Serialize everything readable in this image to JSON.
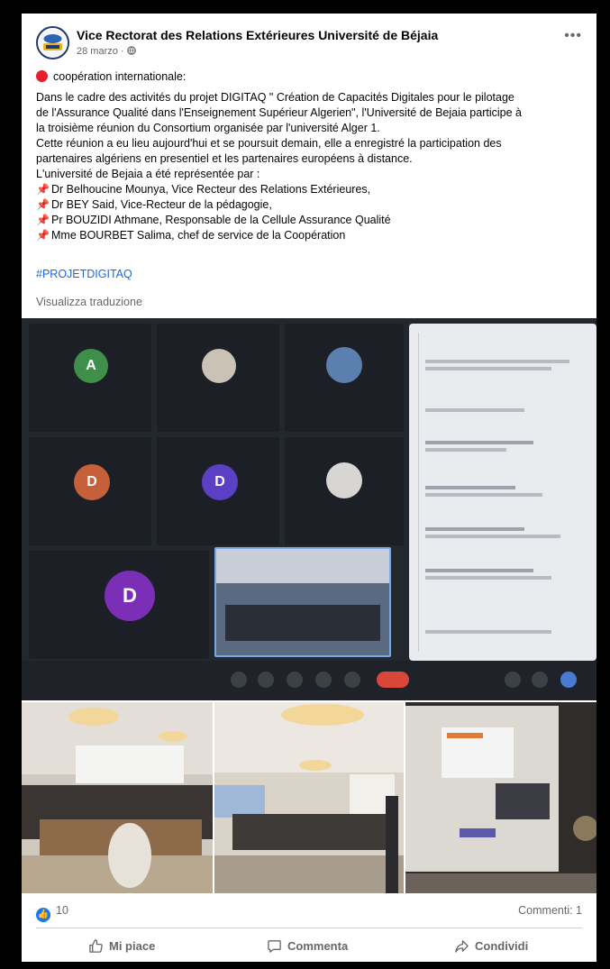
{
  "post": {
    "page_name": "Vice Rectorat des Relations Extérieures Université de Béjaia",
    "date": "28 marzo",
    "date_sep": "·",
    "category_line": "coopération internationale:",
    "paragraph_lines": [
      " Dans le cadre des activités du projet DIGITAQ \" Création de Capacités Digitales pour le pilotage",
      "de l'Assurance Qualité dans l'Enseignement Supérieur Algerien\", l'Université de Bejaia participe à",
      "la troisième réunion du Consortium organisée par l'université Alger 1.",
      "Cette réunion a eu lieu aujourd'hui et se poursuit demain, elle a enregistré la participation des",
      "partenaires algériens en presentiel et les partenaires européens à distance.",
      "L'université de Bejaia a été représentée par :"
    ],
    "representatives": [
      "Dr Belhoucine Mounya, Vice Recteur des Relations Extérieures,",
      "Dr BEY Said, Vice-Recteur de la pédagogie,",
      "Pr BOUZIDI Athmane, Responsable de la Cellule Assurance Qualité",
      "Mme BOURBET Salima, chef de service de la Coopération"
    ],
    "hashtag": "#PROJETDIGITAQ",
    "translate_link": "Visualizza traduzione"
  },
  "stats": {
    "likes": "10",
    "comments": "Commenti: 1"
  },
  "actions": {
    "like": "Mi piace",
    "comment": "Commenta",
    "share": "Condividi"
  },
  "icons": {
    "category": "red-circle-icon",
    "pin": "pushpin-icon",
    "like_badge": "thumbs-up-icon",
    "like": "thumbs-up-outline-icon",
    "comment": "speech-bubble-icon",
    "share": "share-arrow-icon",
    "more": "ellipsis-icon",
    "audience": "globe-icon"
  },
  "colors": {
    "link": "#1a68d8",
    "like_badge": "#1877f2",
    "category_dot": "#e41e2b"
  }
}
